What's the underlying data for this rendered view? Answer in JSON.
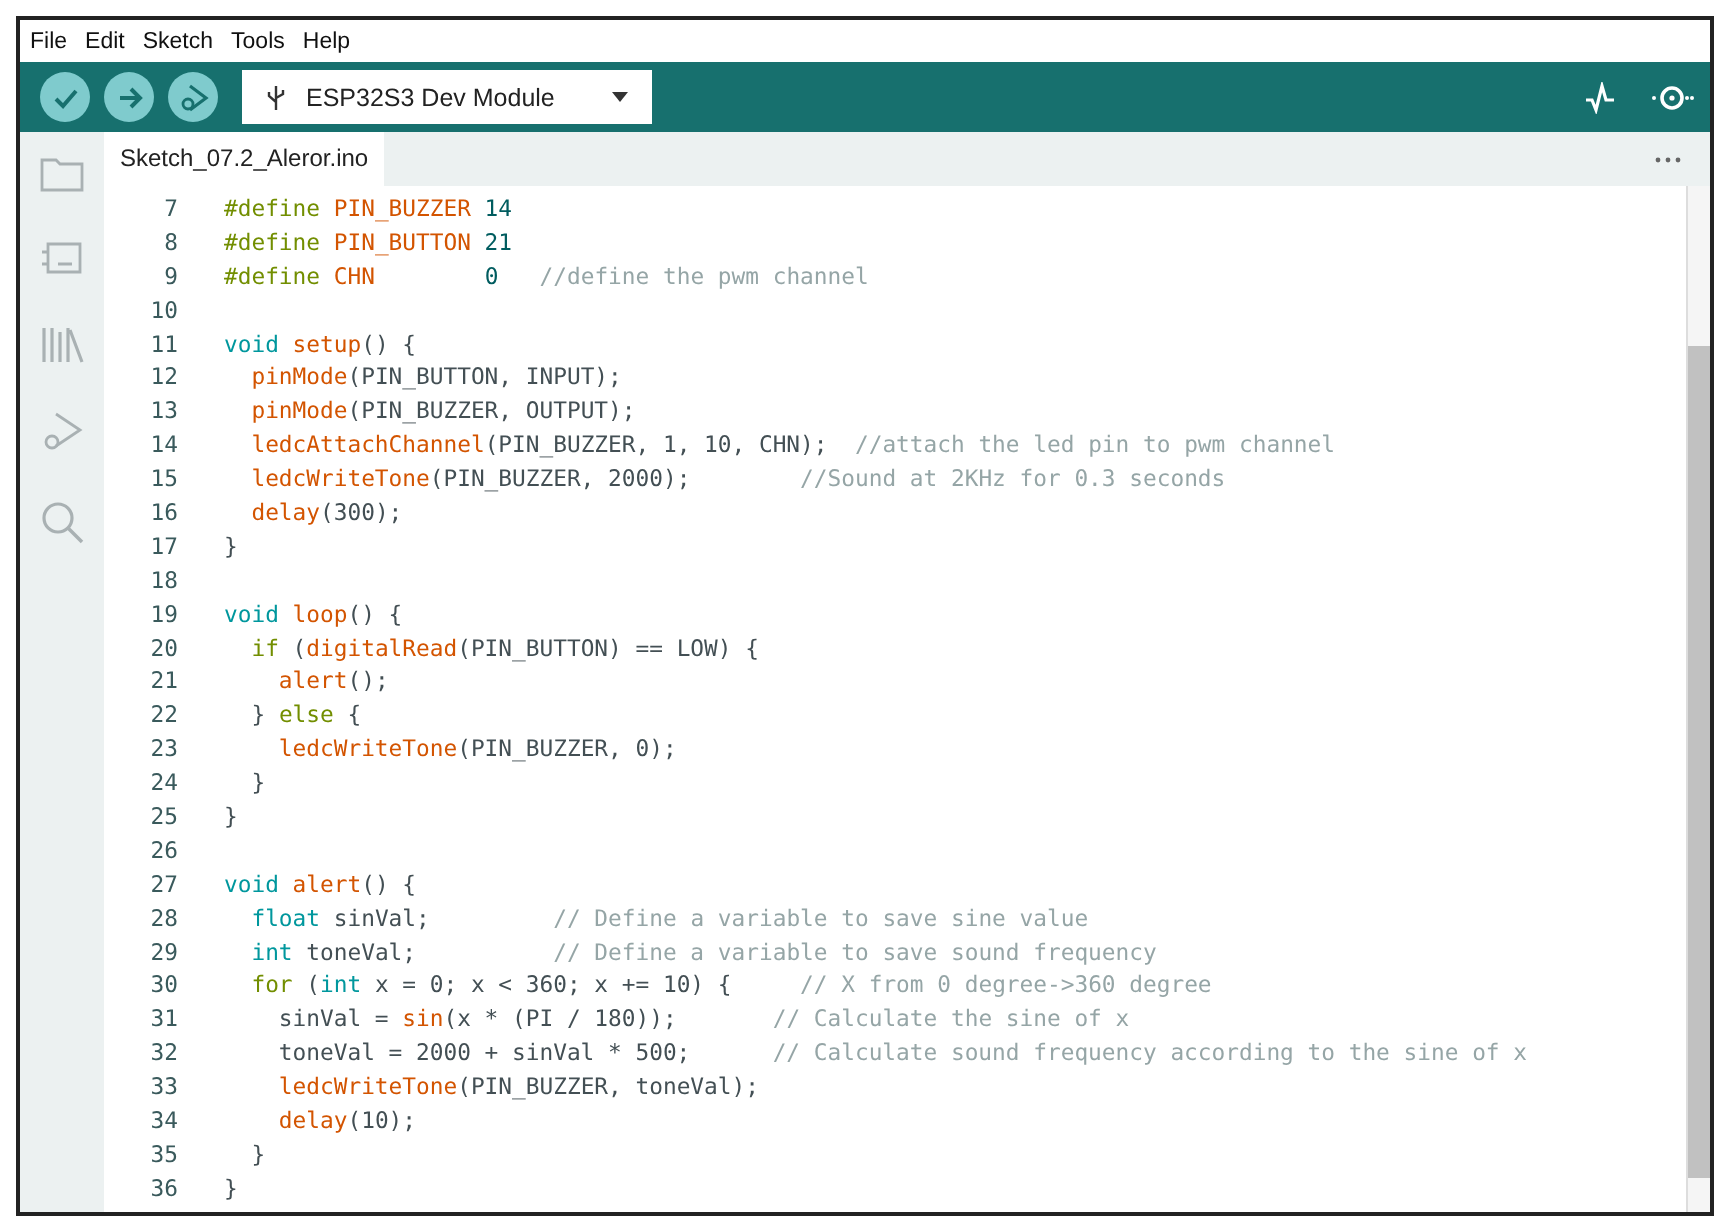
{
  "menu_bar": [
    "File",
    "Edit",
    "Sketch",
    "Tools",
    "Help"
  ],
  "toolbar": {
    "board_selector": "ESP32S3 Dev Module"
  },
  "tabs": [
    {
      "label": "Sketch_07.2_Aleror.ino",
      "selected": true
    }
  ],
  "editor": {
    "lines": [
      {
        "number": "7",
        "tokens": [
          {
            "kind": "directive",
            "text": "#define "
          },
          {
            "kind": "fn",
            "text": "PIN_BUZZER"
          },
          {
            "kind": "num",
            "text": " 14"
          }
        ]
      },
      {
        "number": "8",
        "tokens": [
          {
            "kind": "directive",
            "text": "#define "
          },
          {
            "kind": "fn",
            "text": "PIN_BUTTON"
          },
          {
            "kind": "num",
            "text": " 21"
          }
        ]
      },
      {
        "number": "9",
        "tokens": [
          {
            "kind": "directive",
            "text": "#define "
          },
          {
            "kind": "fn",
            "text": "CHN"
          },
          {
            "kind": "num",
            "text": "        0"
          },
          {
            "kind": "comment",
            "text": "   //define the pwm channel"
          }
        ]
      },
      {
        "number": "10"
      },
      {
        "number": "11",
        "tokens": [
          {
            "kind": "type",
            "text": "void "
          },
          {
            "kind": "fn",
            "text": "setup"
          },
          {
            "kind": "plain",
            "text": "() {"
          }
        ]
      },
      {
        "number": "12",
        "tokens": [
          {
            "kind": "fn",
            "text": "  pinMode"
          },
          {
            "kind": "plain",
            "text": "(PIN_BUTTON, INPUT);"
          }
        ]
      },
      {
        "number": "13",
        "tokens": [
          {
            "kind": "fn",
            "text": "  pinMode"
          },
          {
            "kind": "plain",
            "text": "(PIN_BUZZER, OUTPUT);"
          }
        ]
      },
      {
        "number": "14",
        "tokens": [
          {
            "kind": "fn",
            "text": "  ledcAttachChannel"
          },
          {
            "kind": "plain",
            "text": "(PIN_BUZZER, 1, 10, CHN);"
          },
          {
            "kind": "comment",
            "text": "  //attach the led pin to pwm channel"
          }
        ]
      },
      {
        "number": "15",
        "tokens": [
          {
            "kind": "fn",
            "text": "  ledcWriteTone"
          },
          {
            "kind": "plain",
            "text": "(PIN_BUZZER, 2000);"
          },
          {
            "kind": "comment",
            "text": "        //Sound at 2KHz for 0.3 seconds"
          }
        ]
      },
      {
        "number": "16",
        "tokens": [
          {
            "kind": "fn",
            "text": "  delay"
          },
          {
            "kind": "plain",
            "text": "(300);"
          }
        ]
      },
      {
        "number": "17",
        "tokens": [
          {
            "kind": "plain",
            "text": "}"
          }
        ]
      },
      {
        "number": "18"
      },
      {
        "number": "19",
        "tokens": [
          {
            "kind": "type",
            "text": "void "
          },
          {
            "kind": "fn",
            "text": "loop"
          },
          {
            "kind": "plain",
            "text": "() {"
          }
        ]
      },
      {
        "number": "20",
        "tokens": [
          {
            "kind": "directive",
            "text": "  if"
          },
          {
            "kind": "plain",
            "text": " ("
          },
          {
            "kind": "fn",
            "text": "digitalRead"
          },
          {
            "kind": "plain",
            "text": "(PIN_BUTTON) == LOW) {"
          }
        ]
      },
      {
        "number": "21",
        "tokens": [
          {
            "kind": "fn",
            "text": "    alert"
          },
          {
            "kind": "plain",
            "text": "();"
          }
        ]
      },
      {
        "number": "22",
        "tokens": [
          {
            "kind": "plain",
            "text": "  } "
          },
          {
            "kind": "directive",
            "text": "else"
          },
          {
            "kind": "plain",
            "text": " {"
          }
        ]
      },
      {
        "number": "23",
        "tokens": [
          {
            "kind": "fn",
            "text": "    ledcWriteTone"
          },
          {
            "kind": "plain",
            "text": "(PIN_BUZZER, 0);"
          }
        ]
      },
      {
        "number": "24",
        "tokens": [
          {
            "kind": "plain",
            "text": "  }"
          }
        ]
      },
      {
        "number": "25",
        "tokens": [
          {
            "kind": "plain",
            "text": "}"
          }
        ]
      },
      {
        "number": "26"
      },
      {
        "number": "27",
        "tokens": [
          {
            "kind": "type",
            "text": "void "
          },
          {
            "kind": "fn",
            "text": "alert"
          },
          {
            "kind": "plain",
            "text": "() {"
          }
        ]
      },
      {
        "number": "28",
        "tokens": [
          {
            "kind": "type",
            "text": "  float"
          },
          {
            "kind": "plain",
            "text": " sinVal;"
          },
          {
            "kind": "comment",
            "text": "         // Define a variable to save sine value"
          }
        ]
      },
      {
        "number": "29",
        "tokens": [
          {
            "kind": "type",
            "text": "  int"
          },
          {
            "kind": "plain",
            "text": " toneVal;"
          },
          {
            "kind": "comment",
            "text": "          // Define a variable to save sound frequency"
          }
        ]
      },
      {
        "number": "30",
        "tokens": [
          {
            "kind": "directive",
            "text": "  for"
          },
          {
            "kind": "plain",
            "text": " ("
          },
          {
            "kind": "type",
            "text": "int"
          },
          {
            "kind": "plain",
            "text": " x = 0; x < 360; x += 10) {"
          },
          {
            "kind": "comment",
            "text": "     // X from 0 degree->360 degree"
          }
        ]
      },
      {
        "number": "31",
        "tokens": [
          {
            "kind": "plain",
            "text": "    sinVal = "
          },
          {
            "kind": "fn",
            "text": "sin"
          },
          {
            "kind": "plain",
            "text": "(x * (PI / 180));"
          },
          {
            "kind": "comment",
            "text": "       // Calculate the sine of x"
          }
        ]
      },
      {
        "number": "32",
        "tokens": [
          {
            "kind": "plain",
            "text": "    toneVal = 2000 + sinVal * 500;"
          },
          {
            "kind": "comment",
            "text": "      // Calculate sound frequency according to the sine of x"
          }
        ]
      },
      {
        "number": "33",
        "tokens": [
          {
            "kind": "fn",
            "text": "    ledcWriteTone"
          },
          {
            "kind": "plain",
            "text": "(PIN_BUZZER, toneVal);"
          }
        ]
      },
      {
        "number": "34",
        "tokens": [
          {
            "kind": "fn",
            "text": "    delay"
          },
          {
            "kind": "plain",
            "text": "(10);"
          }
        ]
      },
      {
        "number": "35",
        "tokens": [
          {
            "kind": "plain",
            "text": "  }"
          }
        ]
      },
      {
        "number": "36",
        "tokens": [
          {
            "kind": "plain",
            "text": "}"
          }
        ]
      }
    ]
  }
}
